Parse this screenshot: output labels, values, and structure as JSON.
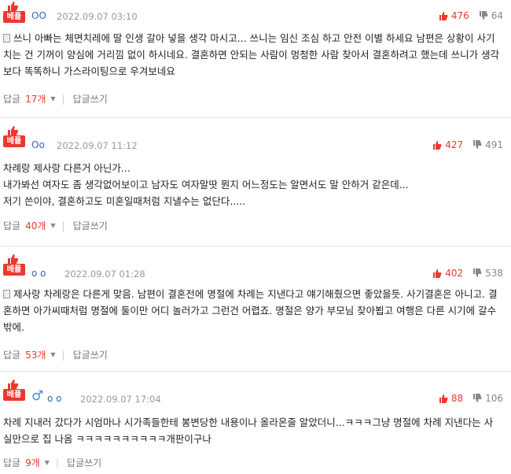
{
  "comments": [
    {
      "badge": "베플",
      "nickname": "OO",
      "date": "2022.09.07 03:10",
      "up": "476",
      "down": "64",
      "body": [
        "쓰니 아빠는 체면치레에 딸 인생 갈아 넣을 생각 마시고... 쓰니는 임신 조심 하고 안전 이별 하세요 남편은 상황이 사기치는 건 기꺼이 양심에 거리낌 없이 하시네요. 결혼하면 안되는 사람이 멍청한 사람 찾아서 결혼하려고 했는데 쓰니가 생각보다 똑똑하니 가스라이팅으로 우겨보네요"
      ],
      "reply_label": "답글",
      "reply_count": "17개",
      "write_label": "답글쓰기"
    },
    {
      "badge": "베플",
      "nickname": "Oo",
      "date": "2022.09.07 11:12",
      "up": "427",
      "down": "491",
      "body": [
        "차례랑 제사랑 다른거 아닌가...",
        "내가봐선 여자도 좀 생각없어보이고 남자도 여자말땃 뭔지 어느정도는 알면서도 말 안하거 같은데...",
        "저기 쓴이야, 결혼하고도 미혼일때처럼 지낼수는 없단다....."
      ],
      "reply_label": "답글",
      "reply_count": "40개",
      "write_label": "답글쓰기"
    },
    {
      "badge": "베플",
      "nickname": "o o",
      "date": "2022.09.07 01:28",
      "up": "402",
      "down": "538",
      "body": [
        "제사랑 차례랑은 다른게 맞음. 남편이 결혼전에 명절에 차례는 지낸다고 얘기해줬으면 좋았을듯. 사기결혼은 아니고. 결혼하면 아가씨때처럼 명절에 둘이만 어디 놀러가고 그런건 어렵죠. 명절은 양가 부모님 찾아뵙고 여행은 다른 시기에 갈수밖에."
      ],
      "reply_label": "답글",
      "reply_count": "53개",
      "write_label": "답글쓰기"
    },
    {
      "badge": "베플",
      "nickname": "o o",
      "gender_icon": "♂",
      "date": "2022.09.07 17:04",
      "up": "88",
      "down": "106",
      "body": [
        "차례 지내러 갔다가 시엄마나 시가족들한테 봉변당한 내용이나 올라온줄 알았더니...ㅋㅋㅋ그냥 명절에 차례 지낸다는 사실만으로 집 나옴 ㅋㅋㅋㅋㅋㅋㅋㅋㅋㅋ개판이구나"
      ],
      "reply_label": "답글",
      "reply_count": "9개",
      "write_label": "답글쓰기"
    }
  ],
  "colors": {
    "accent": "#e8392f",
    "nickname": "#3a63b3",
    "muted": "#999999"
  },
  "icons": [
    "thumbs-up-icon",
    "thumbs-down-icon",
    "document-icon",
    "male-icon",
    "caret-down-icon"
  ]
}
